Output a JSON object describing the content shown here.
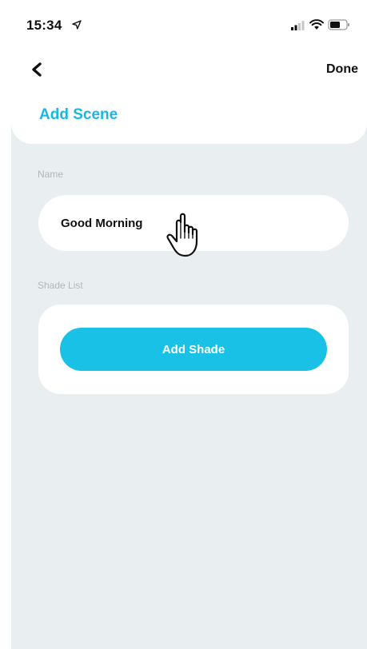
{
  "status_bar": {
    "time": "15:34",
    "icons": [
      "location-arrow-icon",
      "signal-icon",
      "wifi-icon",
      "battery-icon"
    ]
  },
  "nav": {
    "back_icon": "chevron-left-icon",
    "done_label": "Done"
  },
  "page": {
    "title": "Add Scene"
  },
  "name_section": {
    "label": "Name",
    "value": "Good Morning"
  },
  "shade_section": {
    "label": "Shade List",
    "add_button_label": "Add Shade"
  },
  "colors": {
    "accent": "#19c1e6",
    "title": "#19b8e3",
    "background": "#e9eef0",
    "card": "#ffffff",
    "label": "#b0b8bc"
  }
}
